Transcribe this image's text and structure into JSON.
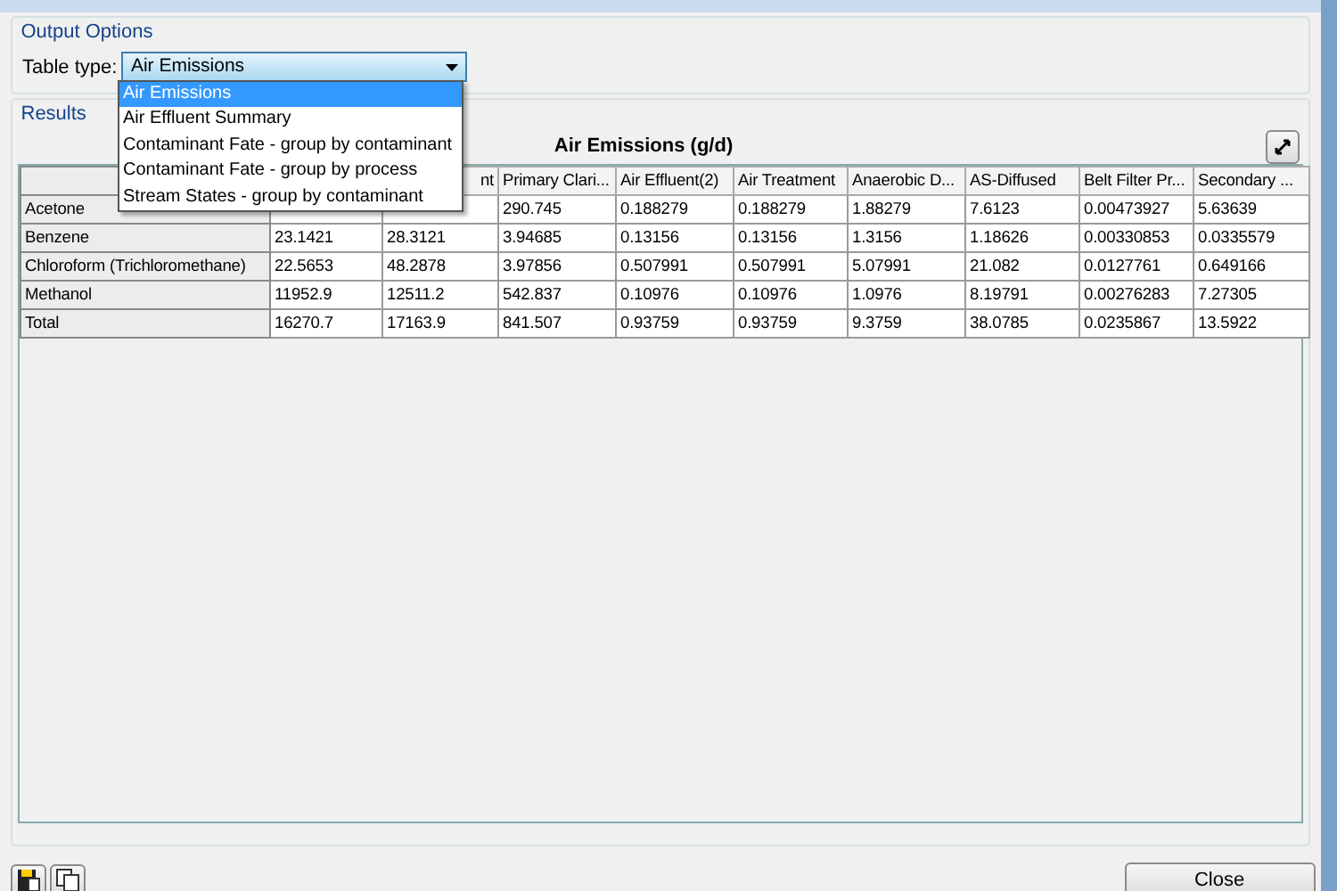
{
  "output_options": {
    "title": "Output Options",
    "table_type_label": "Table type:",
    "table_type": {
      "value": "Air Emissions",
      "expanded": true,
      "options": [
        {
          "label": "Air Emissions",
          "selected": true
        },
        {
          "label": "Air Effluent Summary",
          "selected": false
        },
        {
          "label": "Contaminant Fate - group by contaminant",
          "selected": false
        },
        {
          "label": "Contaminant Fate - group by process",
          "selected": false
        },
        {
          "label": "Stream States - group by contaminant",
          "selected": false
        }
      ]
    }
  },
  "results": {
    "title": "Results",
    "table_title": "Air Emissions (g/d)",
    "columns": [
      null,
      "nt",
      "Primary Clari...",
      "Air Effluent(2)",
      "Air Treatment",
      "Anaerobic D...",
      "AS-Diffused",
      "Belt Filter Pr...",
      "Secondary ..."
    ],
    "rows": [
      {
        "name": "Acetone",
        "cells": [
          null,
          null,
          "290.745",
          "0.188279",
          "0.188279",
          "1.88279",
          "7.6123",
          "0.00473927",
          "5.63639"
        ]
      },
      {
        "name": "Benzene",
        "cells": [
          "23.1421",
          "28.3121",
          "3.94685",
          "0.13156",
          "0.13156",
          "1.3156",
          "1.18626",
          "0.00330853",
          "0.0335579"
        ]
      },
      {
        "name": "Chloroform (Trichloromethane)",
        "cells": [
          "22.5653",
          "48.2878",
          "3.97856",
          "0.507991",
          "0.507991",
          "5.07991",
          "21.082",
          "0.0127761",
          "0.649166"
        ]
      },
      {
        "name": "Methanol",
        "cells": [
          "11952.9",
          "12511.2",
          "542.837",
          "0.10976",
          "0.10976",
          "1.0976",
          "8.19791",
          "0.00276283",
          "7.27305"
        ]
      },
      {
        "name": "Total",
        "cells": [
          "16270.7",
          "17163.9",
          "841.507",
          "0.93759",
          "0.93759",
          "9.3759",
          "38.0785",
          "0.0235867",
          "13.5922"
        ]
      }
    ]
  },
  "buttons": {
    "close": "Close"
  }
}
